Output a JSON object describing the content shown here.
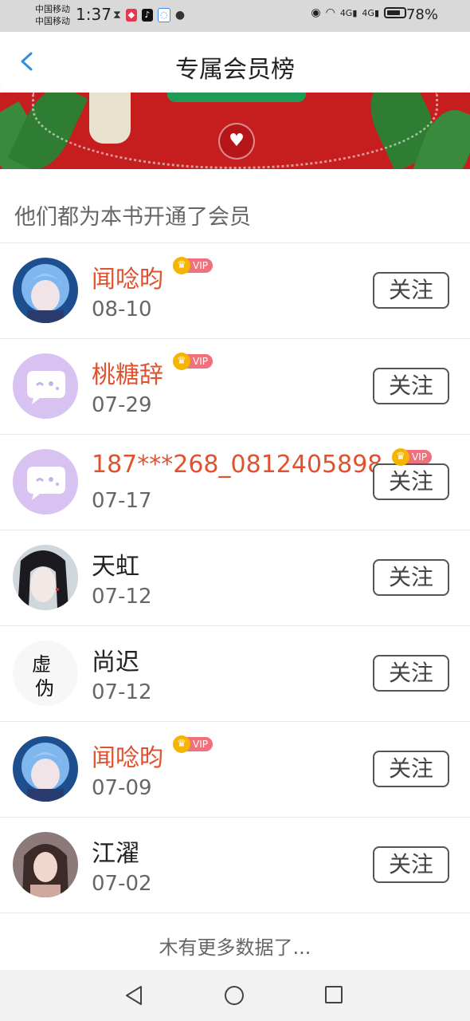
{
  "status_bar": {
    "carrier_1": "中国移动",
    "carrier_2": "中国移动",
    "time": "1:37",
    "battery": "78%",
    "network_1": "4G",
    "network_2": "4G"
  },
  "header": {
    "title": "专属会员榜"
  },
  "section": {
    "title": "他们都为本书开通了会员"
  },
  "colors": {
    "vip_name": "#e0522f",
    "banner": "#c61d1f",
    "vip_badge": "#f0707c",
    "crown": "#f5b400"
  },
  "vip_label": "VIP",
  "follow_label": "关注",
  "members": [
    {
      "name": "闻唸昀",
      "date": "08-10",
      "vip": true,
      "avatar": "anime-boy-blue-hair"
    },
    {
      "name": "桃糖辞",
      "date": "07-29",
      "vip": true,
      "avatar": "chat-bubble-default"
    },
    {
      "name": "187***268_0812405898",
      "date": "07-17",
      "vip": true,
      "avatar": "chat-bubble-default"
    },
    {
      "name": "天虹",
      "date": "07-12",
      "vip": false,
      "avatar": "dark-hair-man"
    },
    {
      "name": "尚迟",
      "date": "07-12",
      "vip": false,
      "avatar": "calligraphy"
    },
    {
      "name": "闻唸昀",
      "date": "07-09",
      "vip": true,
      "avatar": "anime-boy-blue-hair"
    },
    {
      "name": "江濯",
      "date": "07-02",
      "vip": false,
      "avatar": "woman-portrait"
    }
  ],
  "footer": {
    "no_more": "木有更多数据了..."
  },
  "avatar_text": {
    "calligraphy": "虚伪"
  }
}
